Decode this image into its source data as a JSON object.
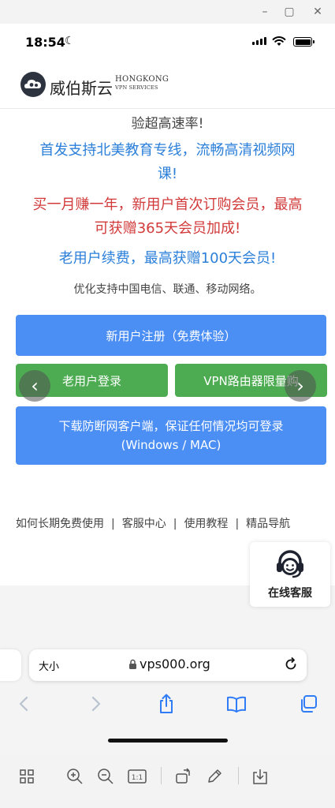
{
  "status_bar": {
    "time": "18:54"
  },
  "header": {
    "logo_cn": "威伯斯云",
    "logo_en_line1": "HONGKONG",
    "logo_en_line2": "VPN SERVICES"
  },
  "promo": {
    "line1": "验超高速率!",
    "line2a": "首发支持北美教育专线，流畅高清视频网",
    "line2b": "课!",
    "line3a": "买一月赚一年，新用户首次订购会员，最高",
    "line3b": "可获赠365天会员加成!",
    "line4": "老用户续费，最高获赠100天会员!",
    "line5": "优化支持中国电信、联通、移动网络。"
  },
  "buttons": {
    "register": "新用户注册（免费体验）",
    "login": "老用户登录",
    "router": "VPN路由器限量购",
    "download_line1": "下载防断网客户端，保证任何情况均可登录",
    "download_line2": "(Windows / MAC)"
  },
  "footer_links": [
    "如何长期免费使用",
    "客服中心",
    "使用教程",
    "精品导航"
  ],
  "support_widget": {
    "label": "在线客服"
  },
  "browser": {
    "text_size_label": "大小",
    "url": "vps000.org"
  },
  "colors": {
    "blue_text": "#2b7fd9",
    "red_text": "#d23a3a",
    "blue_button": "#4b8ef4",
    "green_button": "#4dac52"
  }
}
